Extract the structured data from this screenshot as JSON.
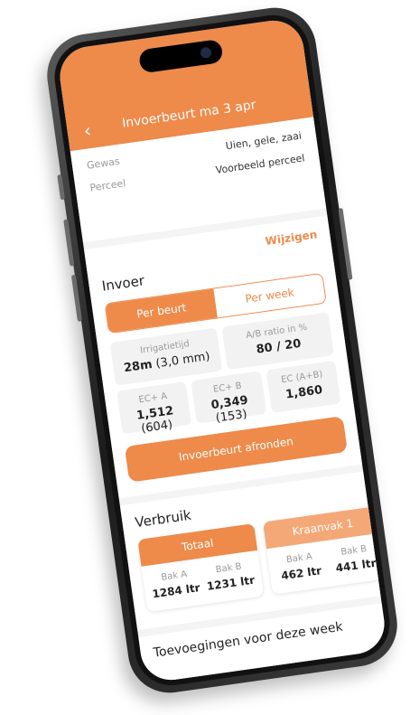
{
  "header": {
    "title": "Invoerbeurt ma 3 apr",
    "back_icon": "chevron-left-icon"
  },
  "info": {
    "rows": [
      {
        "label": "Gewas",
        "value": "Uien, gele, zaai"
      },
      {
        "label": "Perceel",
        "value": "Voorbeeld perceel"
      }
    ]
  },
  "invoer": {
    "edit_label": "Wijzigen",
    "title": "Invoer",
    "tabs": [
      {
        "label": "Per beurt",
        "active": true
      },
      {
        "label": "Per week",
        "active": false
      }
    ],
    "metrics_top": [
      {
        "label": "Irrigatietijd",
        "value": "28m",
        "extra": "(3,0 mm)"
      },
      {
        "label": "A/B ratio in %",
        "value": "80 / 20",
        "extra": ""
      }
    ],
    "metrics_bottom": [
      {
        "label": "EC+ A",
        "value": "1,512",
        "extra": "(604)"
      },
      {
        "label": "EC+ B",
        "value": "0,349",
        "extra": "(153)"
      },
      {
        "label": "EC (A+B)",
        "value": "1,860",
        "extra": ""
      }
    ],
    "finish_button": "Invoerbeurt afronden"
  },
  "verbruik": {
    "title": "Verbruik",
    "cards": [
      {
        "title": "Totaal",
        "bak_a_label": "Bak A",
        "bak_a_value": "1284 ltr",
        "bak_b_label": "Bak B",
        "bak_b_value": "1231 ltr"
      },
      {
        "title": "Kraanvak 1",
        "bak_a_label": "Bak A",
        "bak_a_value": "462 ltr",
        "bak_b_label": "Bak B",
        "bak_b_value": "441 ltr"
      }
    ]
  },
  "toevoegingen": {
    "title": "Toevoegingen voor deze week"
  },
  "colors": {
    "accent": "#ee8a4a",
    "accent_light": "#f4a877",
    "background": "#f4f4f4"
  }
}
